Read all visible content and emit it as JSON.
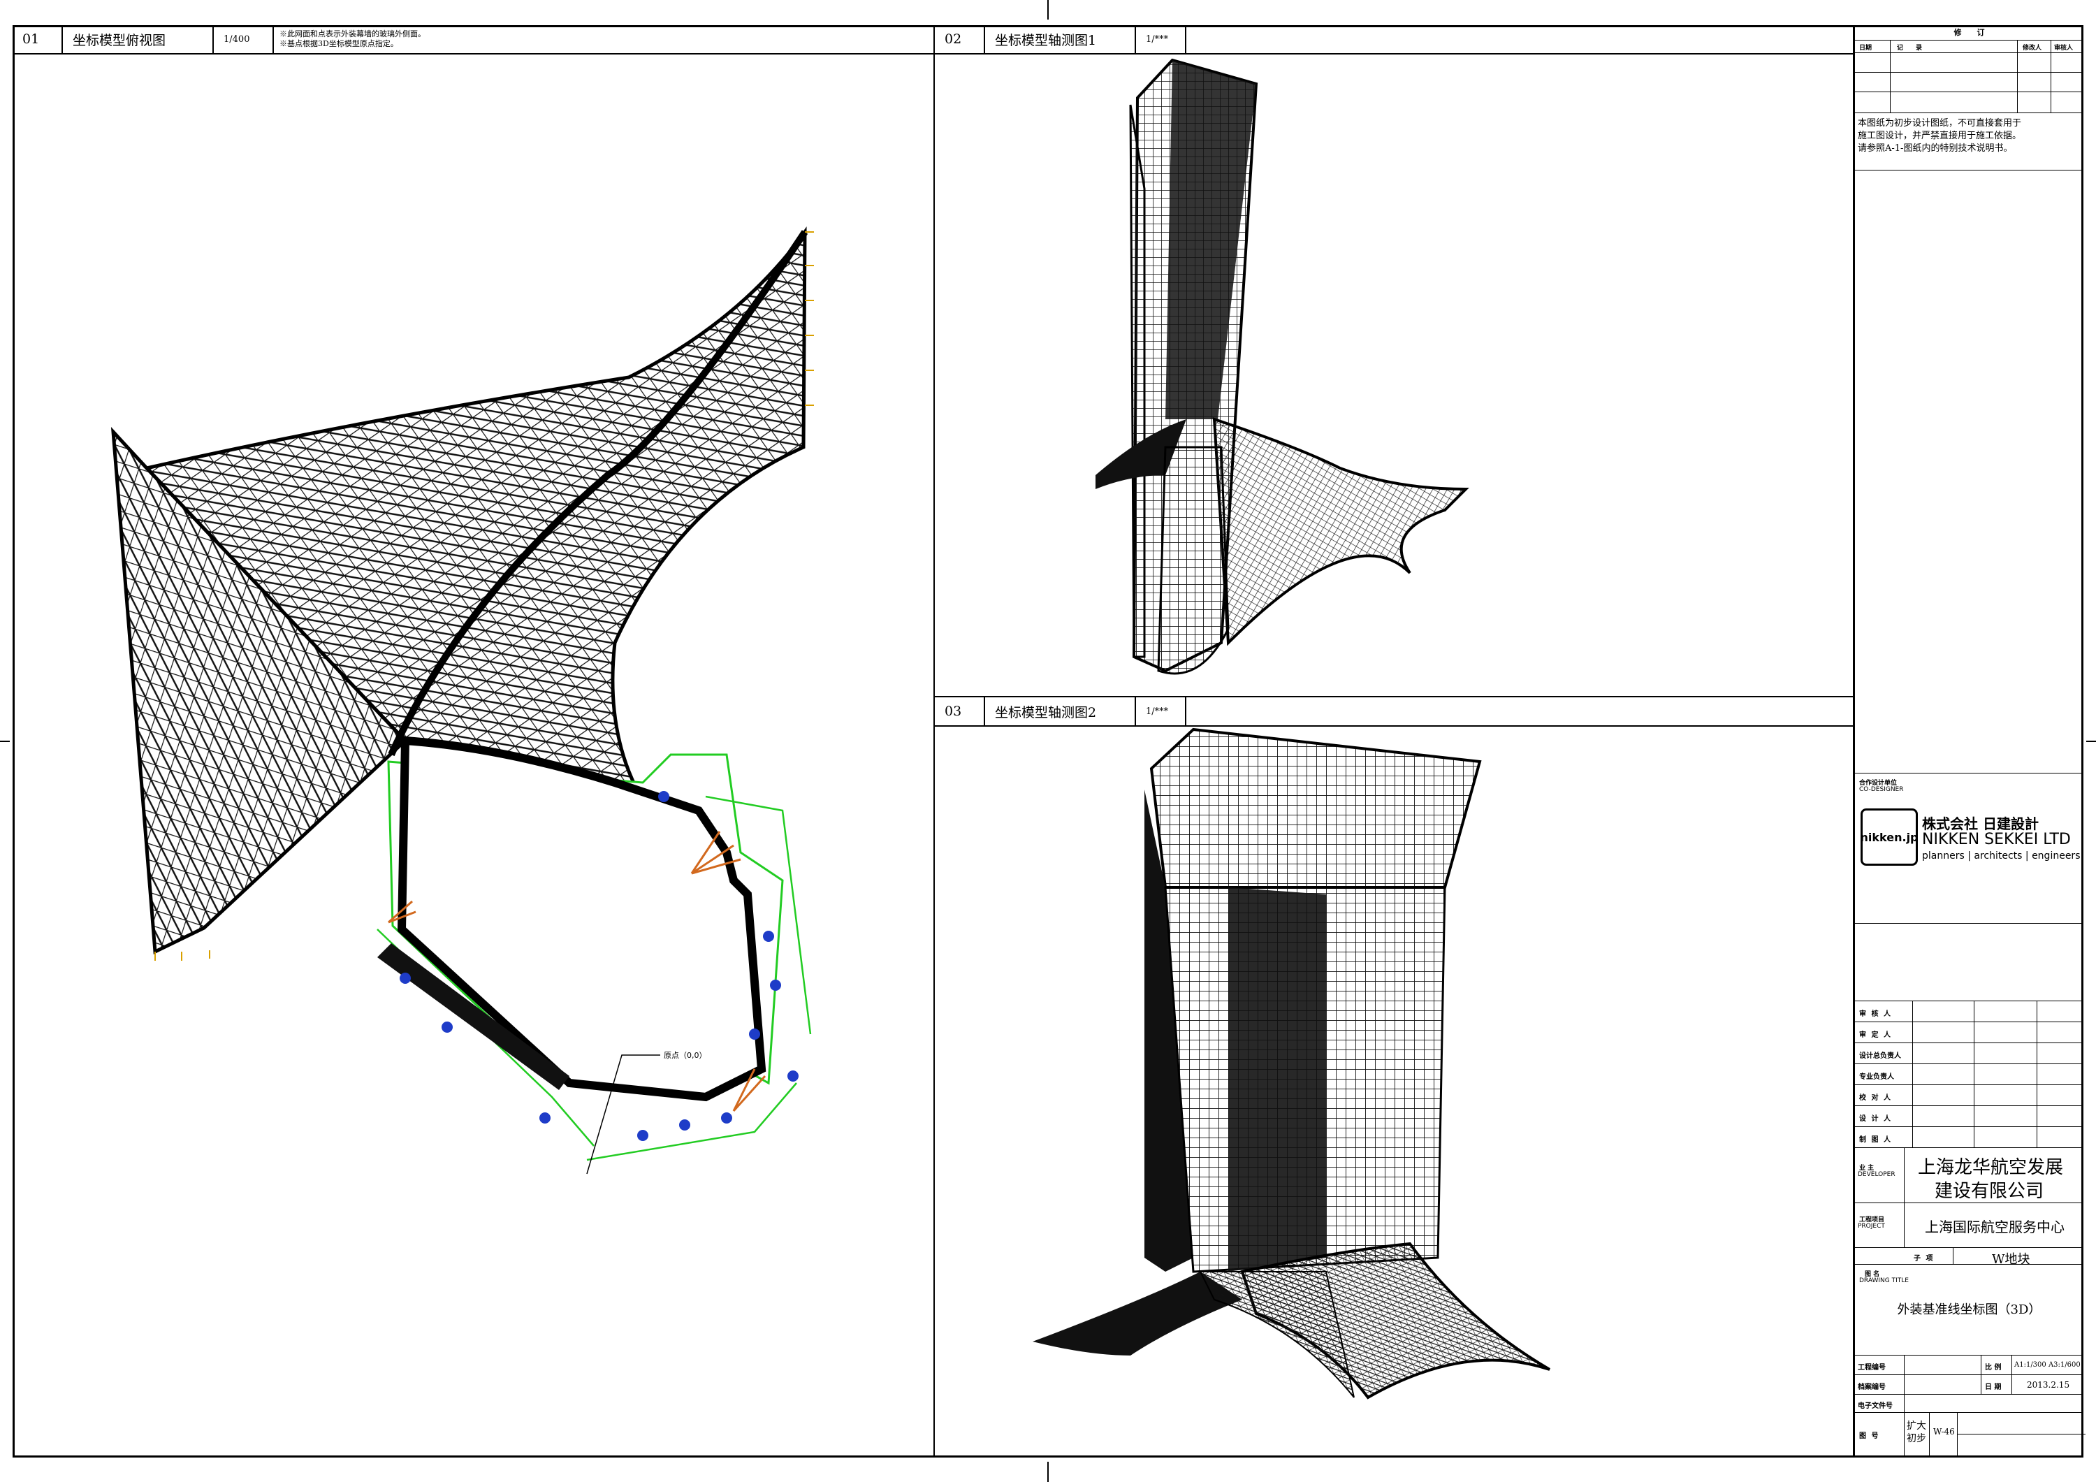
{
  "views": [
    {
      "num": "01",
      "title": "坐标模型俯视图",
      "scale": "1/400",
      "notes": [
        "※此网面和点表示外装幕墙的玻璃外侧面。",
        "※基点根据3D坐标模型原点指定。"
      ]
    },
    {
      "num": "02",
      "title": "坐标模型轴测图1",
      "scale": "1/***"
    },
    {
      "num": "03",
      "title": "坐标模型轴测图2",
      "scale": "1/***"
    }
  ],
  "plan_label": "原点（0,0）",
  "revision": {
    "title": "修　　订",
    "cols": [
      "日期",
      "记　　录",
      "修改人",
      "审核人"
    ]
  },
  "disclaimer": [
    "本图纸为初步设计图纸，不可直接套用于",
    "施工图设计，并严禁直接用于施工依据。",
    "请参照A-1-图纸内的特别技术说明书。"
  ],
  "codesigner": {
    "label_cn": "合作设计单位",
    "label_en": "CO-DESIGNER"
  },
  "logo": {
    "badge": "nikken.jp",
    "cn": "株式会社 日建設計",
    "en": "NIKKEN SEKKEI LTD",
    "tag": "planners | architects | engineers"
  },
  "signatures": [
    "审 核 人",
    "审 定 人",
    "设计总负责人",
    "专业负责人",
    "校 对 人",
    "设 计 人",
    "制 图 人"
  ],
  "developer": {
    "label_cn": "业 主",
    "label_en": "DEVELOPER",
    "line1": "上海龙华航空发展",
    "line2": "建设有限公司"
  },
  "project": {
    "label_cn": "工程项目",
    "label_en": "PROJECT",
    "name": "上海国际航空服务中心",
    "sub_label": "子 项",
    "sub_value": "W地块"
  },
  "drawing_title": {
    "label_cn": "图 名",
    "label_en": "DRAWING TITLE",
    "value": "外装基准线坐标图（3D）"
  },
  "meta": {
    "project_no_label": "工程编号",
    "archive_no_label": "档案编号",
    "efile_label": "电子文件号",
    "ratio_label": "比 例",
    "ratio_value": "A1:1/300 A3:1/600",
    "date_label": "日 期",
    "date_value": "2013.2.15",
    "dwg_no_label": "图 号",
    "stage1": "扩大",
    "stage2": "初步",
    "dwg_no": "W-46"
  },
  "colors": {
    "frame": "#000000",
    "mesh": "#111111",
    "green": "#22cc22",
    "orange": "#d2691e",
    "blue": "#1e3cc8"
  }
}
